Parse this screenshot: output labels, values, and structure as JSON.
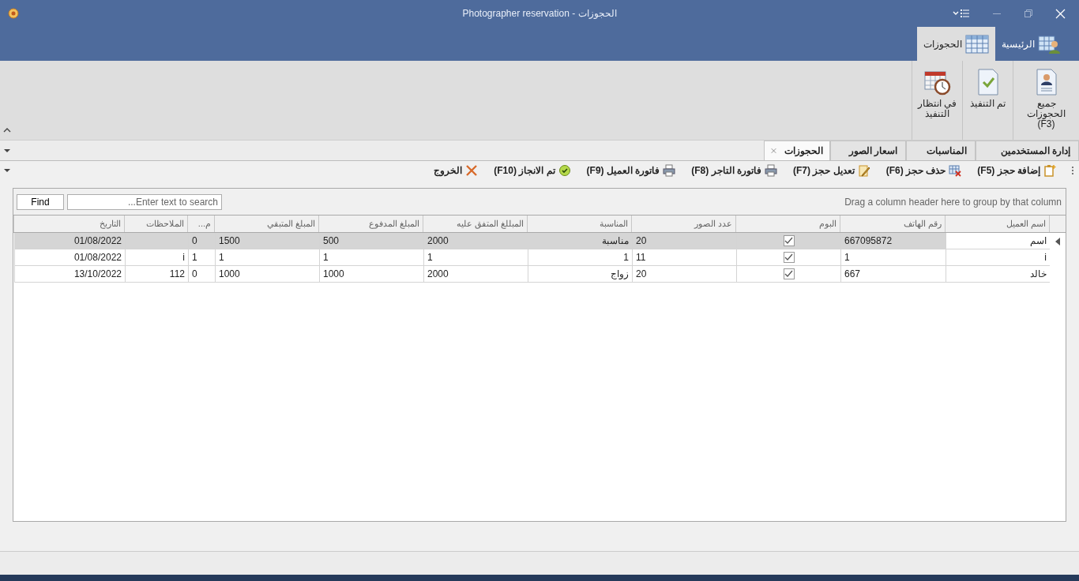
{
  "window": {
    "title": "Photographer reservation - الحجوزات"
  },
  "ribbon_tabs": [
    {
      "label": "الرئيسية",
      "selected": false
    },
    {
      "label": "الحجوزات",
      "selected": true
    }
  ],
  "ribbon_buttons": [
    {
      "label": "جميع الحجوزات (F3)",
      "kind": "person"
    },
    {
      "label": "تم التنفيذ",
      "kind": "check"
    },
    {
      "label": "في انتظار التنفيذ",
      "kind": "calendar"
    }
  ],
  "doc_tabs": [
    {
      "label": "إدارة المستخدمين",
      "selected": false,
      "closable": false
    },
    {
      "label": "المناسبات",
      "selected": false,
      "closable": false
    },
    {
      "label": "اسعار الصور",
      "selected": false,
      "closable": false
    },
    {
      "label": "الحجوزات",
      "selected": true,
      "closable": true
    }
  ],
  "toolbar": [
    {
      "label": "إضافة حجز (F5)",
      "kind": "add"
    },
    {
      "label": "حذف حجز (F6)",
      "kind": "delete"
    },
    {
      "label": "تعديل حجز (F7)",
      "kind": "edit"
    },
    {
      "label": "فاتورة التاجر (F8)",
      "kind": "print"
    },
    {
      "label": "فاتورة العميل (F9)",
      "kind": "print"
    },
    {
      "label": "تم الانجاز (F10)",
      "kind": "done"
    },
    {
      "label": "الخروج",
      "kind": "exit"
    }
  ],
  "group_panel": "Drag a column header here to group by that column",
  "search": {
    "placeholder": "Enter text to search...",
    "button": "Find"
  },
  "table": {
    "columns": [
      "اسم العميل",
      "رقم الهاتف",
      "البوم",
      "عدد الصور",
      "المناسبة",
      "المبللغ المتفق عليه",
      "المبلغ المدفوع",
      "المبلغ المتبقي",
      "م...",
      "الملاحظات",
      "التاريخ"
    ],
    "rows": [
      {
        "selected": true,
        "cells": [
          "اسم",
          "667095872",
          true,
          "20",
          "مناسبة",
          "2000",
          "500",
          "1500",
          "0",
          "",
          "01/08/2022"
        ]
      },
      {
        "selected": false,
        "cells": [
          "i",
          "1",
          true,
          "11",
          "1",
          "1",
          "1",
          "1",
          "1",
          "i",
          "01/08/2022"
        ]
      },
      {
        "selected": false,
        "cells": [
          "خالد",
          "667",
          true,
          "20",
          "زواج",
          "2000",
          "1000",
          "1000",
          "0",
          "112",
          "13/10/2022"
        ]
      }
    ]
  }
}
